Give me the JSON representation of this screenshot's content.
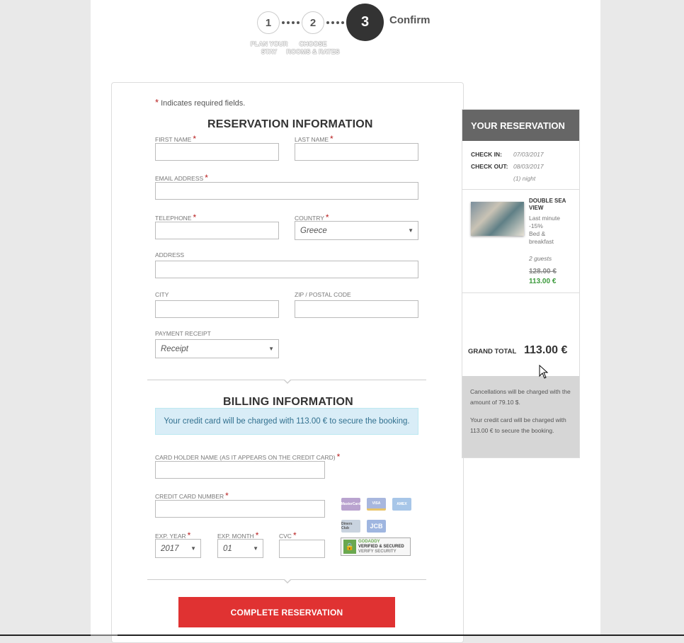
{
  "steps": {
    "items": [
      {
        "number": "1",
        "label_line1": "PLAN YOUR",
        "label_line2": "STAY"
      },
      {
        "number": "2",
        "label_line1": "CHOOSE",
        "label_line2": "ROOMS & RATES"
      },
      {
        "number": "3",
        "title": "Confirm"
      }
    ]
  },
  "form": {
    "required_note": "Indicates required fields.",
    "required_mark": "*",
    "reservation_title": "RESERVATION INFORMATION",
    "first_name_label": "FIRST NAME",
    "last_name_label": "LAST NAME",
    "email_label": "EMAIL ADDRESS",
    "telephone_label": "TELEPHONE",
    "country_label": "COUNTRY",
    "country_value": "Greece",
    "address_label": "ADDRESS",
    "city_label": "CITY",
    "zip_label": "ZIP / POSTAL CODE",
    "payment_receipt_label": "PAYMENT RECEIPT",
    "payment_receipt_value": "Receipt",
    "billing_title": "BILLING INFORMATION",
    "billing_alert": "Your credit card will be charged with 113.00 € to secure the booking.",
    "card_holder_label": "CARD HOLDER NAME (AS IT APPEARS ON THE CREDIT CARD)",
    "card_number_label": "CREDIT CARD NUMBER",
    "exp_year_label": "EXP. YEAR",
    "exp_year_value": "2017",
    "exp_month_label": "EXP. MONTH",
    "exp_month_value": "01",
    "cvc_label": "CVC",
    "card_logos": [
      "MasterCard",
      "VISA",
      "AMEX",
      "Diners Club",
      "JCB"
    ],
    "godaddy_line1": "GODADDY",
    "godaddy_line2": "VERIFIED & SECURED",
    "godaddy_line3": "VERIFY SECURITY",
    "submit_label": "COMPLETE RESERVATION"
  },
  "reservation": {
    "title": "YOUR RESERVATION",
    "check_in_label": "CHECK IN:",
    "check_in_value": "07/03/2017",
    "check_out_label": "CHECK OUT:",
    "check_out_value": "08/03/2017",
    "nights": "(1) night",
    "room_name": "DOUBLE SEA VIEW",
    "rate_line1": "Last minute",
    "rate_line2": "-15%",
    "board_line1": "Bed &",
    "board_line2": "breakfast",
    "guests": "2 guests",
    "price_old": "128.00 €",
    "price_new": "113.00 €",
    "grand_total_label": "GRAND TOTAL",
    "grand_total_value": "113.00 €",
    "cancellation_note": "Cancellations will be charged with the amount of 79.10 $.",
    "charge_note": "Your credit card will be charged with 113.00 € to secure the booking."
  },
  "colors": {
    "accent_red": "#e03232",
    "step_active": "#333333",
    "sidebar_header": "#666666",
    "price_new_green": "#3c9a3c",
    "alert_bg": "#d9edf7"
  }
}
